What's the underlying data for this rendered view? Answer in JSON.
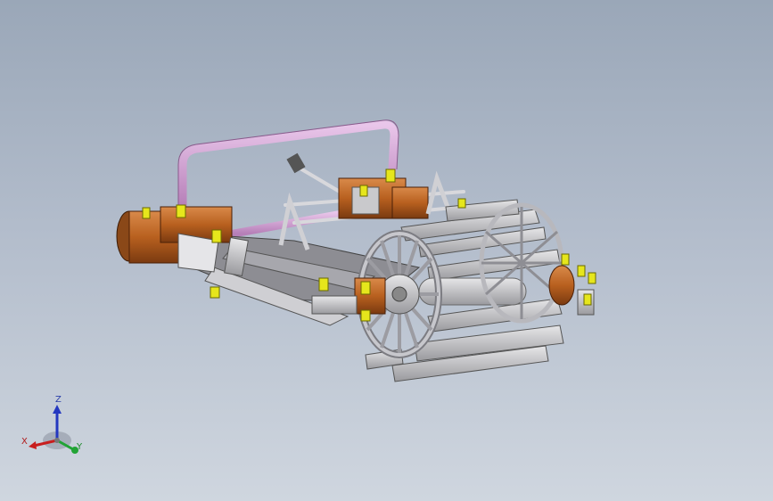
{
  "viewport": {
    "background_top": "#9aa7b8",
    "background_bottom": "#cfd6df"
  },
  "model": {
    "subject": "paddle-wheel-mechanism-assembly",
    "colors": {
      "frame_pipe": "#d7a3d8",
      "motor_housing": "#c26a2a",
      "sheet_metal": "#c9c9cc",
      "bolts": "#e8e81e"
    }
  },
  "triad": {
    "x_label": "X",
    "y_label": "Y",
    "z_label": "Z",
    "x_color": "#c81e1e",
    "y_color": "#21a335",
    "z_color": "#2438c0"
  }
}
